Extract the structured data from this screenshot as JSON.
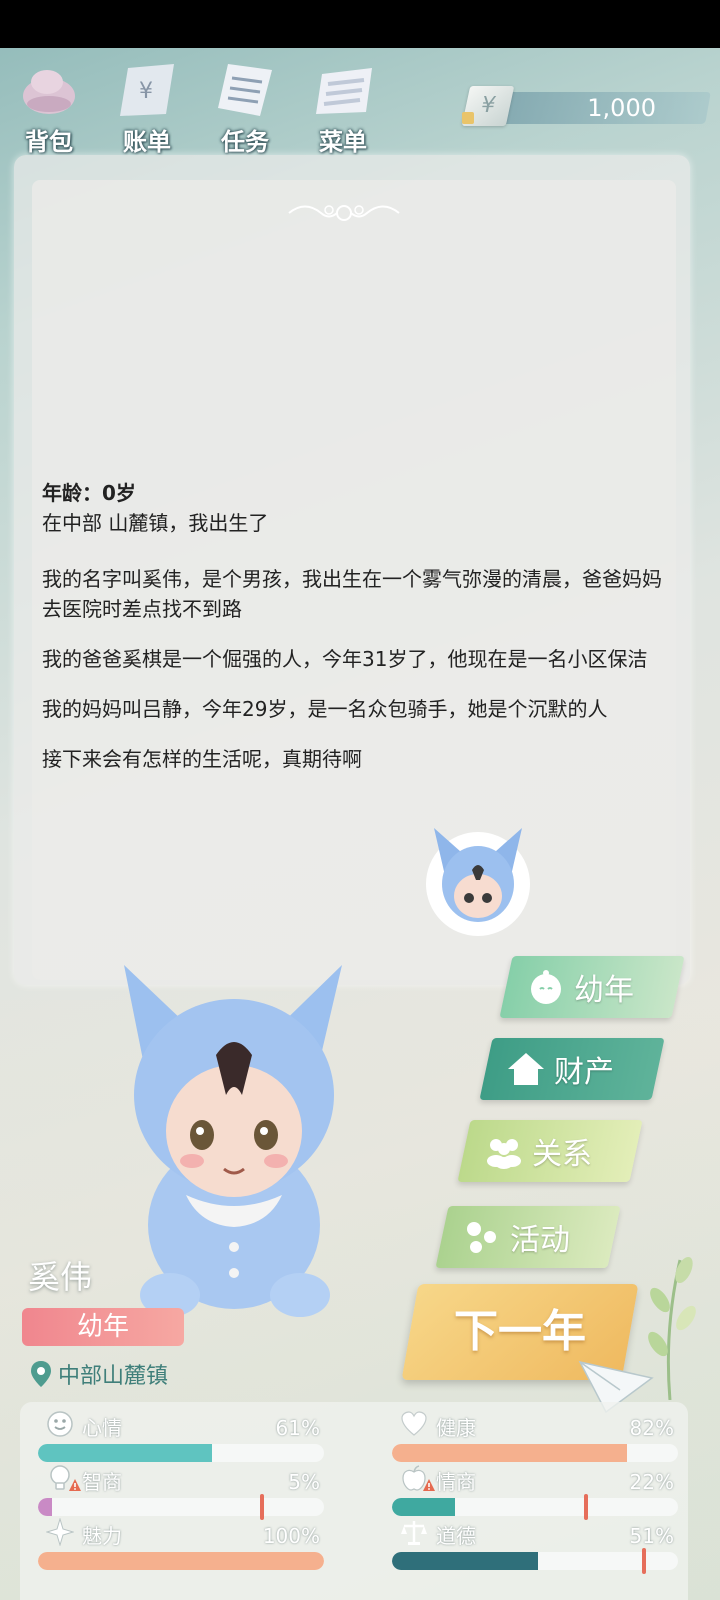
{
  "toolbar": {
    "items": [
      {
        "label": "背包",
        "icon": "backpack-icon"
      },
      {
        "label": "账单",
        "icon": "bill-icon"
      },
      {
        "label": "任务",
        "icon": "task-icon"
      },
      {
        "label": "菜单",
        "icon": "menu-icon"
      }
    ],
    "currency_symbol": "¥",
    "money": "1,000"
  },
  "story": {
    "age_line": "年龄：0岁",
    "paragraphs": [
      "在中部 山麓镇，我出生了",
      "我的名字叫奚伟，是个男孩，我出生在一个雾气弥漫的清晨，爸爸妈妈去医院时差点找不到路",
      "我的爸爸奚棋是一个倔强的人，今年31岁了，他现在是一名小区保洁",
      "我的妈妈叫吕静，今年29岁，是一名众包骑手，她是个沉默的人",
      "接下来会有怎样的生活呢，真期待啊"
    ]
  },
  "nav": {
    "childhood": "幼年",
    "property": "财产",
    "relations": "关系",
    "activities": "活动",
    "next_year": "下一年"
  },
  "character": {
    "name": "奚伟",
    "stage": "幼年",
    "location": "中部山麓镇"
  },
  "stats": {
    "mood": {
      "label": "心情",
      "value": "61%",
      "level": 0.61
    },
    "health": {
      "label": "健康",
      "value": "82%",
      "level": 0.82
    },
    "iq": {
      "label": "智商",
      "value": "5%",
      "level": 0.05
    },
    "eq": {
      "label": "情商",
      "value": "22%",
      "level": 0.22
    },
    "charm": {
      "label": "魅力",
      "value": "100%",
      "level": 1.0
    },
    "morality": {
      "label": "道德",
      "value": "51%",
      "level": 0.51
    }
  },
  "colors": {
    "mood": "#5fc4c0",
    "health": "#f5b08e",
    "iq": "#c98ac5",
    "eq": "#3fa9a0",
    "charm": "#f5b08e",
    "morality": "#2f6f7a",
    "childhood_btn": "#7bc7a0",
    "property_btn": "#3e9d86",
    "relations_btn": "#b7d486",
    "activities_btn": "#a9d08a"
  }
}
